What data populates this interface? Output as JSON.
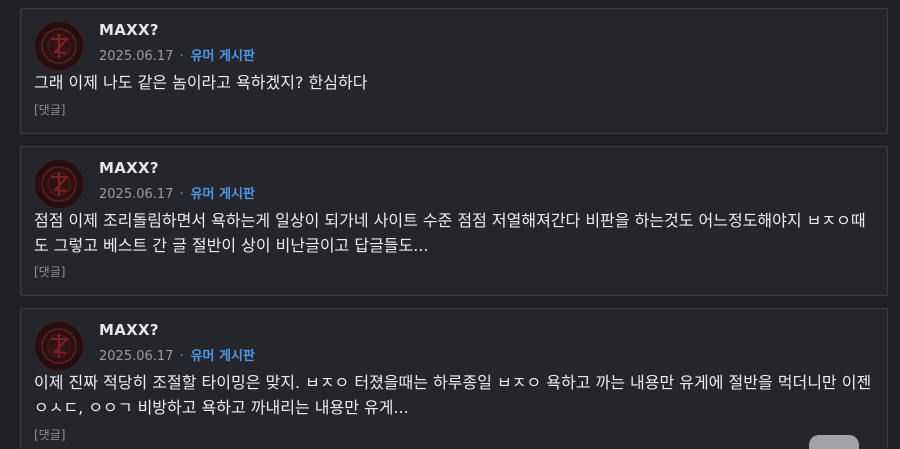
{
  "posts": [
    {
      "author": "MAXX?",
      "date": "2025.06.17",
      "separator": "·",
      "board": "유머 게시판",
      "body": "그래 이제 나도 같은 놈이라고 욕하겠지? 한심하다",
      "reply": "[댓글]"
    },
    {
      "author": "MAXX?",
      "date": "2025.06.17",
      "separator": "·",
      "board": "유머 게시판",
      "body": "점점 이제 조리돌림하면서 욕하는게 일상이 되가네 사이트 수준 점점 저열해져간다 비판을 하는것도 어느정도해야지 ㅂㅈㅇ때도 그렇고 베스트 간 글 절반이 상이 비난글이고 답글들도...",
      "reply": "[댓글]"
    },
    {
      "author": "MAXX?",
      "date": "2025.06.17",
      "separator": "·",
      "board": "유머 게시판",
      "body": "이제 진짜 적당히 조절할 타이밍은 맞지. ㅂㅈㅇ 터졌을때는 하루종일 ㅂㅈㅇ 욕하고 까는 내용만 유게에 절반을 먹더니만 이젠 ㅇㅅㄷ, ㅇㅇㄱ 비방하고 욕하고 까내리는 내용만 유게...",
      "reply": "[댓글]"
    }
  ],
  "colors": {
    "background": "#1f2126",
    "card": "#24262b",
    "board_link": "#4f95e8"
  },
  "icons": {
    "avatar": "dark-red-emblem-avatar",
    "scroll": "scroll-to-top-button"
  }
}
